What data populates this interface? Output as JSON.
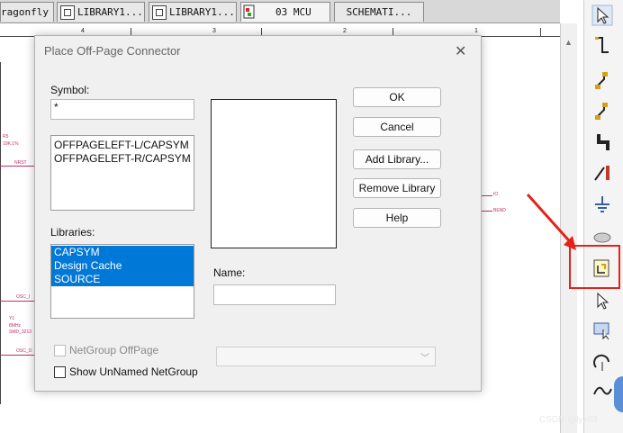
{
  "tabs": [
    {
      "label": "ragonfly",
      "icon": "none"
    },
    {
      "label": "LIBRARY1...",
      "icon": "library-icon"
    },
    {
      "label": "LIBRARY1...",
      "icon": "library-icon"
    },
    {
      "label": "03 MCU",
      "icon": "schematic-page-icon"
    },
    {
      "label": "SCHEMATI...",
      "icon": "none"
    }
  ],
  "ruler": {
    "ticks": [
      "4",
      "3",
      "2",
      "1"
    ]
  },
  "schematic_labels": [
    "NRST",
    "10K,1%",
    "OSC_I",
    "OSC_O",
    "Y1",
    "8MHz",
    "SMD_3213",
    "IO",
    "BEND",
    "R5"
  ],
  "dialog": {
    "title": "Place Off-Page Connector",
    "close_glyph": "✕",
    "symbol_label": "Symbol:",
    "symbol_value": "*",
    "symbol_list": [
      "OFFPAGELEFT-L/CAPSYM",
      "OFFPAGELEFT-R/CAPSYM"
    ],
    "libraries_label": "Libraries:",
    "libraries": [
      "CAPSYM",
      "Design Cache",
      "SOURCE"
    ],
    "buttons": {
      "ok": "OK",
      "cancel": "Cancel",
      "add_library": "Add Library...",
      "remove_library": "Remove Library",
      "help": "Help"
    },
    "name_label": "Name:",
    "name_value": "",
    "netgroup_offpage_label": "NetGroup OffPage",
    "show_unnamed_label": "Show UnNamed NetGroup",
    "netgroup_offpage_checked": false,
    "show_unnamed_checked": false,
    "netgroup_combo_value": ""
  },
  "toolbar_icons": [
    "select-arrow-icon",
    "wire-icon",
    "bus-entry-icon",
    "net-alias-icon",
    "bus-icon",
    "power-icon",
    "ground-icon",
    "off-page-connector-icon",
    "select-icon",
    "place-part-icon",
    "arc-icon"
  ],
  "highlight_color": "#e2231a",
  "selection_color": "#0078d7",
  "watermark": "CSDN @lyx03"
}
